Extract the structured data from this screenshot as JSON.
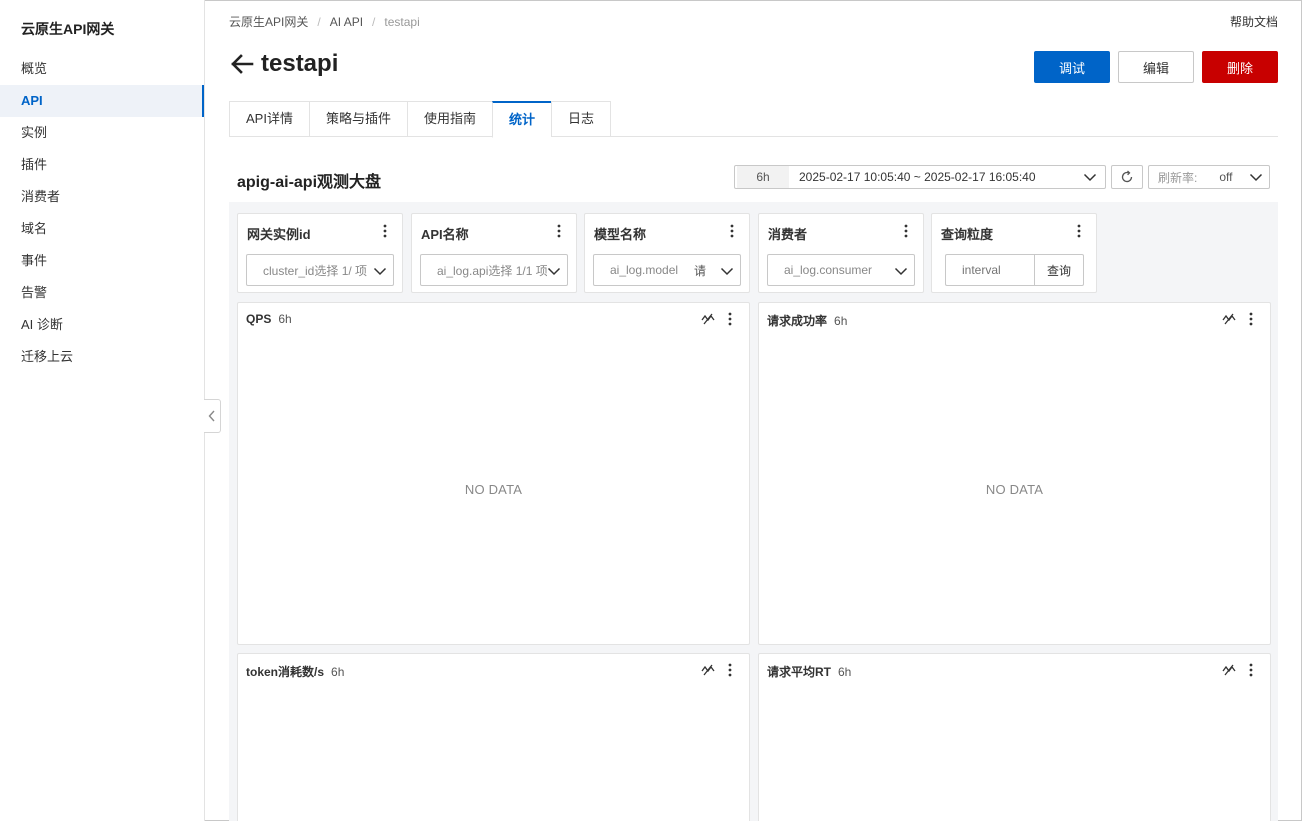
{
  "sidebar": {
    "brand": "云原生API网关",
    "items": [
      {
        "label": "概览",
        "active": false
      },
      {
        "label": "API",
        "active": true
      },
      {
        "label": "实例",
        "active": false
      },
      {
        "label": "插件",
        "active": false
      },
      {
        "label": "消费者",
        "active": false
      },
      {
        "label": "域名",
        "active": false
      },
      {
        "label": "事件",
        "active": false
      },
      {
        "label": "告警",
        "active": false
      },
      {
        "label": "AI 诊断",
        "active": false
      },
      {
        "label": "迁移上云",
        "active": false
      }
    ]
  },
  "breadcrumb": {
    "items": [
      "云原生API网关",
      "AI API",
      "testapi"
    ],
    "separator": "/"
  },
  "header": {
    "help": "帮助文档",
    "title": "testapi",
    "actions": {
      "debug": "调试",
      "edit": "编辑",
      "delete": "删除"
    }
  },
  "tabs": [
    {
      "label": "API详情",
      "active": false
    },
    {
      "label": "策略与插件",
      "active": false
    },
    {
      "label": "使用指南",
      "active": false
    },
    {
      "label": "统计",
      "active": true
    },
    {
      "label": "日志",
      "active": false
    }
  ],
  "dashboard": {
    "title": "apig-ai-api观测大盘",
    "time_quick": "6h",
    "time_range": "2025-02-17 10:05:40 ~ 2025-02-17 16:05:40",
    "refresh_label": "刷新率:",
    "refresh_value": "off"
  },
  "filters": {
    "cluster": {
      "label": "网关实例id",
      "value": "cluster_id选择 1/ 项"
    },
    "api_name": {
      "label": "API名称",
      "value": "ai_log.api选择 1/1 项"
    },
    "model": {
      "label": "模型名称",
      "value": "ai_log.model",
      "suffix": "请"
    },
    "consumer": {
      "label": "消费者",
      "value": "ai_log.consumer"
    },
    "granularity": {
      "label": "查询粒度",
      "placeholder": "interval",
      "button": "查询"
    }
  },
  "panels": {
    "qps": {
      "title": "QPS",
      "range": "6h",
      "empty": "NO DATA"
    },
    "success_rate": {
      "title": "请求成功率",
      "range": "6h",
      "empty": "NO DATA"
    },
    "token_rate": {
      "title": "token消耗数/s",
      "range": "6h"
    },
    "avg_rt": {
      "title": "请求平均RT",
      "range": "6h"
    }
  },
  "colors": {
    "primary": "#0064c8",
    "danger": "#c80000",
    "dashboard_bg": "#f4f5f7"
  }
}
